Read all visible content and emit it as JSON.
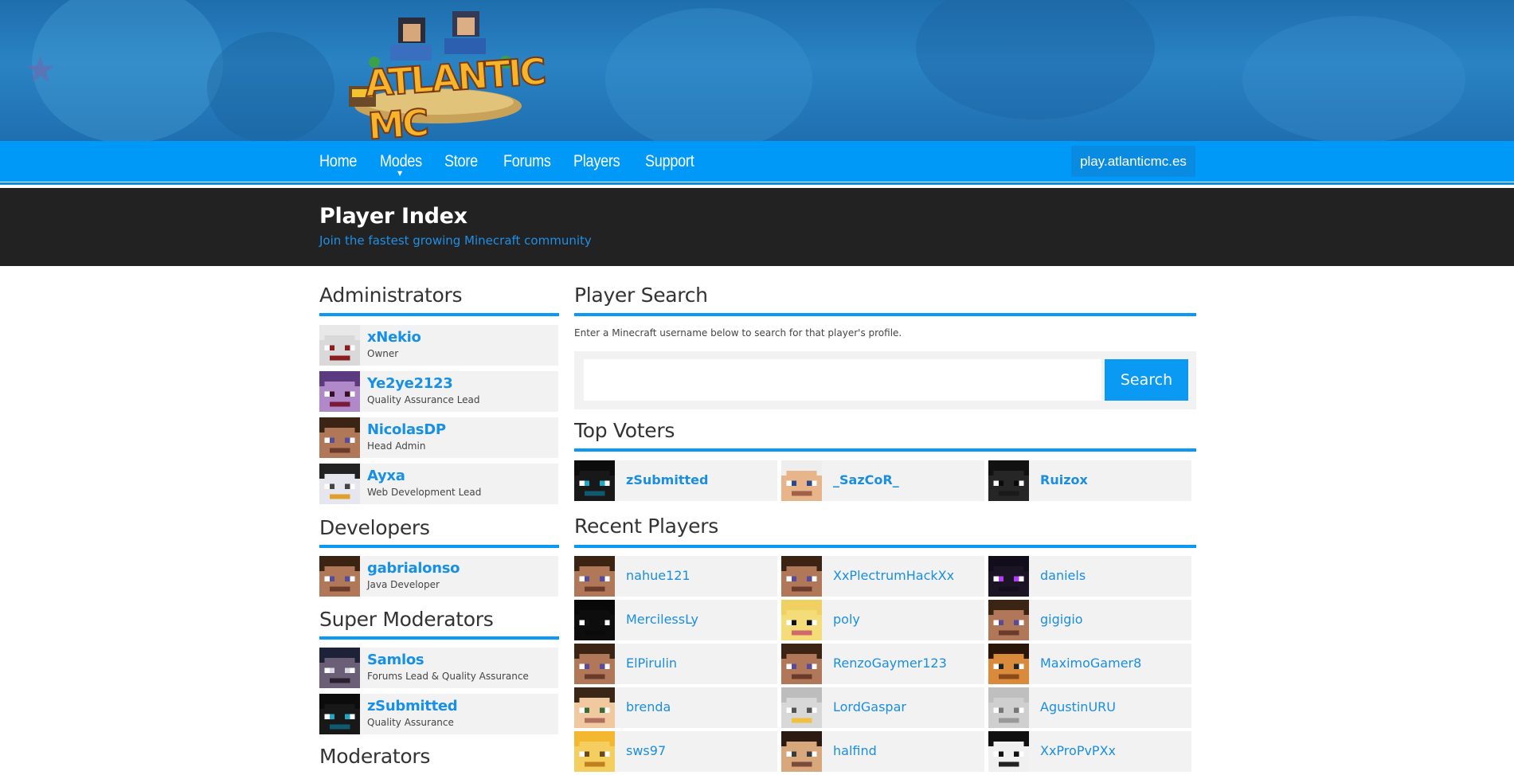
{
  "site": {
    "logo_text": "ATLANTIC MC",
    "nav": [
      "Home",
      "Modes",
      "Store",
      "Forums",
      "Players",
      "Support"
    ],
    "server_ip": "play.atlanticmc.es"
  },
  "page": {
    "title": "Player Index",
    "subtitle": "Join the fastest growing Minecraft community"
  },
  "sections": {
    "administrators": "Administrators",
    "developers": "Developers",
    "super_moderators": "Super Moderators",
    "moderators": "Moderators",
    "player_search": "Player Search",
    "top_voters": "Top Voters",
    "recent_players": "Recent Players"
  },
  "administrators": [
    {
      "name": "xNekio",
      "role": "Owner",
      "avatar": "red-white-skin"
    },
    {
      "name": "Ye2ye2123",
      "role": "Quality Assurance Lead",
      "avatar": "purple-skin"
    },
    {
      "name": "NicolasDP",
      "role": "Head Admin",
      "avatar": "steve-skin"
    },
    {
      "name": "Ayxa",
      "role": "Web Development Lead",
      "avatar": "penguin-skin"
    }
  ],
  "developers": [
    {
      "name": "gabrialonso",
      "role": "Java Developer",
      "avatar": "steve-skin"
    }
  ],
  "super_moderators": [
    {
      "name": "Samlos",
      "role": "Forums Lead & Quality Assurance",
      "avatar": "dark-hood-skin"
    },
    {
      "name": "zSubmitted",
      "role": "Quality Assurance",
      "avatar": "black-cyan-skin"
    }
  ],
  "search": {
    "description": "Enter a Minecraft username below to search for that player's profile.",
    "placeholder": "",
    "button": "Search"
  },
  "top_voters": [
    {
      "name": "zSubmitted",
      "avatar": "black-cyan-skin"
    },
    {
      "name": "_SazCoR_",
      "avatar": "white-hair-skin"
    },
    {
      "name": "Ruizox",
      "avatar": "dark-skin"
    }
  ],
  "recent_players": [
    {
      "name": "nahue121",
      "avatar": "steve-skin"
    },
    {
      "name": "XxPlectrumHackXx",
      "avatar": "steve-skin"
    },
    {
      "name": "daniels",
      "avatar": "enderman-skin"
    },
    {
      "name": "MercilessLy",
      "avatar": "black-skin"
    },
    {
      "name": "poly",
      "avatar": "yellow-sunglasses-skin"
    },
    {
      "name": "gigigio",
      "avatar": "steve-skin"
    },
    {
      "name": "ElPirulin",
      "avatar": "steve-skin"
    },
    {
      "name": "RenzoGaymer123",
      "avatar": "steve-skin"
    },
    {
      "name": "MaximoGamer8",
      "avatar": "orange-hair-skin"
    },
    {
      "name": "brenda",
      "avatar": "brown-hair-skin"
    },
    {
      "name": "LordGaspar",
      "avatar": "white-beard-skin"
    },
    {
      "name": "AgustinURU",
      "avatar": "grey-skin"
    },
    {
      "name": "sws97",
      "avatar": "golden-skin"
    },
    {
      "name": "halfind",
      "avatar": "dark-hair-skin"
    },
    {
      "name": "XxProPvPXx",
      "avatar": "black-white-skin"
    }
  ],
  "colors": {
    "accent": "#0a99f3",
    "nav": "#0099f7",
    "titlebar": "#222222",
    "link": "#1790e5"
  }
}
